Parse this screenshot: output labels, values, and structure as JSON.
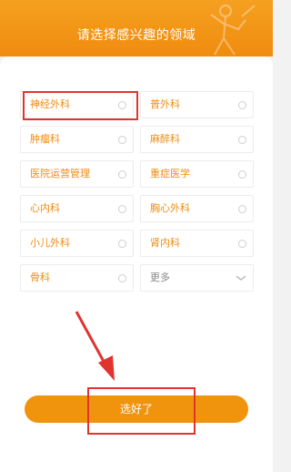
{
  "header": {
    "title": "请选择感兴趣的领域"
  },
  "fields": [
    {
      "label": "神经外科",
      "selected": true
    },
    {
      "label": "普外科",
      "selected": false
    },
    {
      "label": "肿瘤科",
      "selected": false
    },
    {
      "label": "麻醉科",
      "selected": false
    },
    {
      "label": "医院运营管理",
      "selected": false
    },
    {
      "label": "重症医学",
      "selected": false
    },
    {
      "label": "心内科",
      "selected": false
    },
    {
      "label": "胸心外科",
      "selected": false
    },
    {
      "label": "小儿外科",
      "selected": false
    },
    {
      "label": "肾内科",
      "selected": false
    },
    {
      "label": "骨科",
      "selected": false
    }
  ],
  "more": {
    "label": "更多"
  },
  "submit": {
    "label": "选好了"
  },
  "colors": {
    "accent": "#f0940e",
    "annotation": "#e2342f"
  }
}
